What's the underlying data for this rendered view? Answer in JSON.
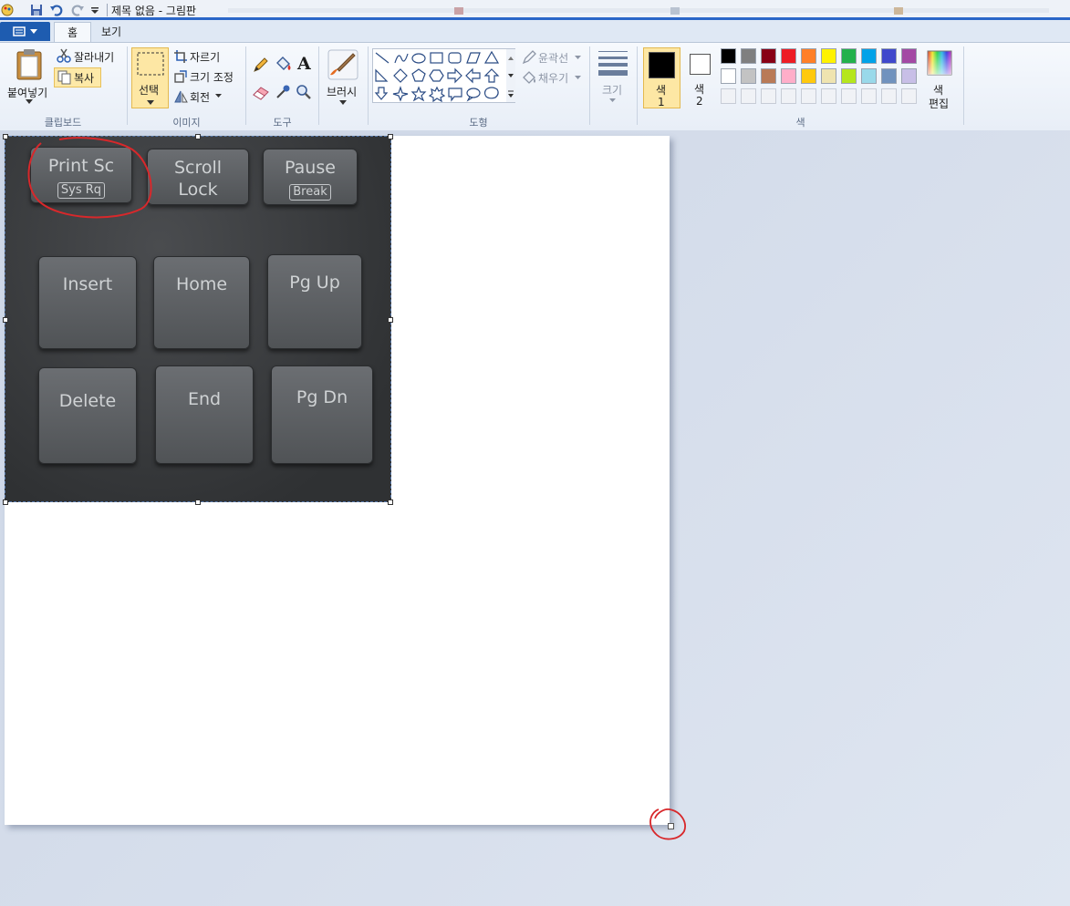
{
  "window": {
    "title": "제목 없음 - 그림판"
  },
  "tabs": [
    {
      "label": "홈"
    },
    {
      "label": "보기"
    }
  ],
  "clipboard": {
    "paste": "붙여넣기",
    "cut": "잘라내기",
    "copy": "복사",
    "group": "클립보드"
  },
  "image": {
    "select": "선택",
    "crop": "자르기",
    "resize": "크기 조정",
    "rotate": "회전",
    "group": "이미지"
  },
  "tools": {
    "group": "도구",
    "text_icon": "A"
  },
  "brush": {
    "label": "브러시"
  },
  "shapes": {
    "outline": "윤곽선",
    "fill": "채우기",
    "group": "도형"
  },
  "size": {
    "label": "크기"
  },
  "colors": {
    "color1": "색",
    "color1_num": "1",
    "color2": "색",
    "color2_num": "2",
    "edit_line1": "색",
    "edit_line2": "편집",
    "group": "색",
    "color1_value": "#000000",
    "color2_value": "#ffffff",
    "palette_row1": [
      "#000000",
      "#7f7f7f",
      "#880015",
      "#ed1c24",
      "#ff7f27",
      "#fff200",
      "#22b14c",
      "#00a2e8",
      "#3f48cc",
      "#a349a4"
    ],
    "palette_row2": [
      "#ffffff",
      "#c3c3c3",
      "#b97a57",
      "#ffaec9",
      "#ffc90e",
      "#efe4b0",
      "#b5e61d",
      "#99d9ea",
      "#7092be",
      "#c8bfe7"
    ]
  },
  "keyboard_photo": {
    "keys": [
      {
        "line1": "Print Sc",
        "sub": "Sys Rq"
      },
      {
        "line1": "Scroll",
        "line2": "Lock"
      },
      {
        "line1": "Pause",
        "sub": "Break"
      },
      {
        "line1": "Insert"
      },
      {
        "line1": "Home"
      },
      {
        "line1": "Pg Up"
      },
      {
        "line1": "Delete"
      },
      {
        "line1": "End"
      },
      {
        "line1": "Pg Dn"
      }
    ]
  }
}
